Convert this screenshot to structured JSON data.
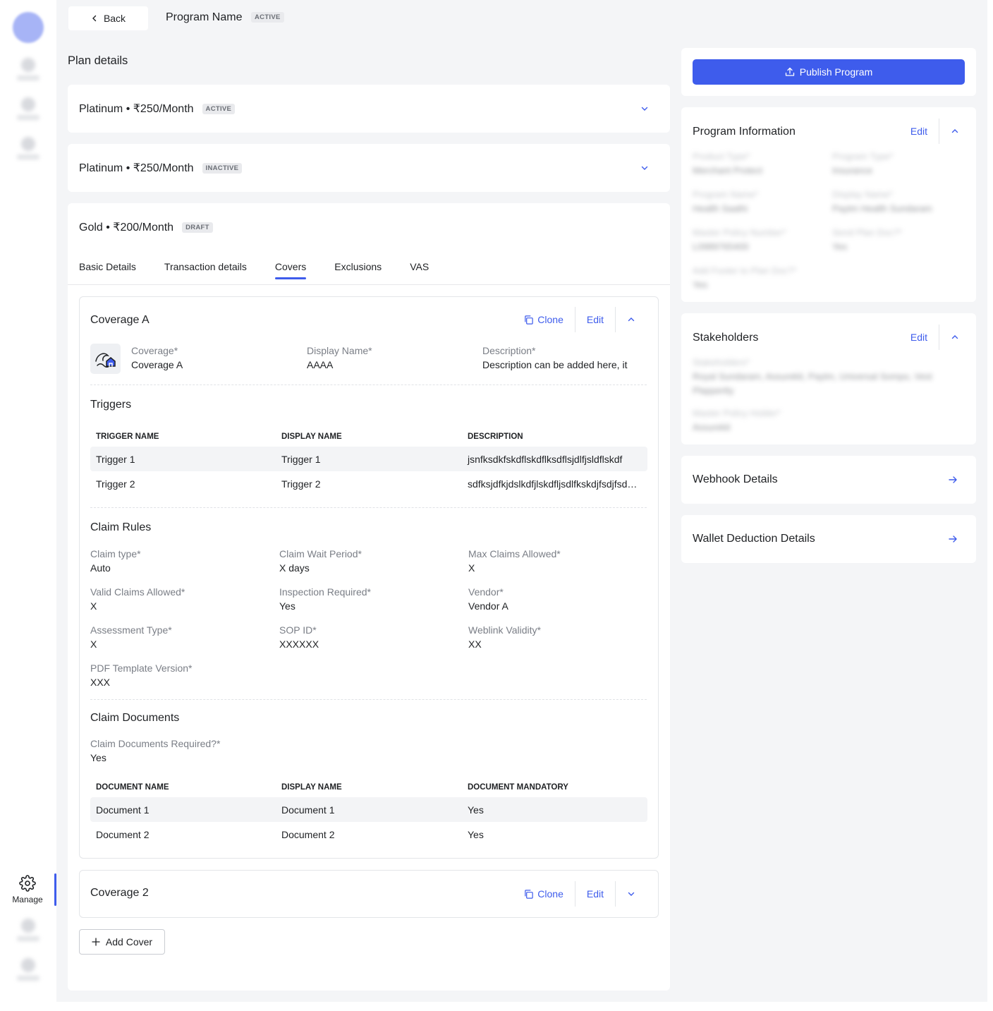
{
  "colors": {
    "accent": "#3e5cec",
    "badge_bg": "#e9eaed",
    "background": "#f4f5f7"
  },
  "sidebar": {
    "manage_label": "Manage",
    "manage_icon": "gear-icon"
  },
  "header": {
    "back_label": "Back",
    "program_name": "Program Name",
    "program_status": "ACTIVE"
  },
  "plan_details": {
    "title": "Plan details",
    "plans": [
      {
        "title": "Platinum • ₹250/Month",
        "status": "ACTIVE"
      },
      {
        "title": "Platinum • ₹250/Month",
        "status": "INACTIVE"
      },
      {
        "title": "Gold • ₹200/Month",
        "status": "DRAFT"
      }
    ]
  },
  "tabs": [
    "Basic Details",
    "Transaction details",
    "Covers",
    "Exclusions",
    "VAS"
  ],
  "active_tab": "Covers",
  "coverage_a": {
    "title": "Coverage A",
    "clone_label": "Clone",
    "edit_label": "Edit",
    "fields": [
      {
        "label": "Coverage*",
        "value": "Coverage A"
      },
      {
        "label": "Display Name*",
        "value": "AAAA"
      },
      {
        "label": "Description*",
        "value": "Description can be added here, it"
      }
    ],
    "triggers": {
      "title": "Triggers",
      "headers": [
        "TRIGGER NAME",
        "DISPLAY NAME",
        "DESCRIPTION"
      ],
      "rows": [
        [
          "Trigger 1",
          "Trigger 1",
          "jsnfksdkfskdflskdflksdflsjdlfjsldflskdf"
        ],
        [
          "Trigger 2",
          "Trigger 2",
          "sdfksjdfkjdslkdfjlskdfljsdlfkskdjfsdjfsdkfjsdf"
        ]
      ]
    },
    "claim_rules": {
      "title": "Claim Rules",
      "fields": [
        {
          "label": "Claim type*",
          "value": "Auto"
        },
        {
          "label": "Claim Wait Period*",
          "value": "X days"
        },
        {
          "label": "Max Claims Allowed*",
          "value": "X"
        },
        {
          "label": "Valid Claims Allowed*",
          "value": "X"
        },
        {
          "label": "Inspection Required*",
          "value": "Yes"
        },
        {
          "label": "Vendor*",
          "value": "Vendor A"
        },
        {
          "label": "Assessment Type*",
          "value": "X"
        },
        {
          "label": "SOP ID*",
          "value": "XXXXXX"
        },
        {
          "label": "Weblink Validity*",
          "value": "XX"
        },
        {
          "label": "PDF Template Version*",
          "value": "XXX"
        }
      ]
    },
    "claim_documents": {
      "title": "Claim Documents",
      "required_label": "Claim Documents Required?*",
      "required_value": "Yes",
      "headers": [
        "DOCUMENT NAME",
        "DISPLAY NAME",
        "DOCUMENT MANDATORY"
      ],
      "rows": [
        [
          "Document 1",
          "Document 1",
          "Yes"
        ],
        [
          "Document 2",
          "Document 2",
          "Yes"
        ]
      ]
    }
  },
  "coverage_2": {
    "title": "Coverage 2",
    "clone_label": "Clone",
    "edit_label": "Edit"
  },
  "add_cover_label": "Add Cover",
  "right": {
    "publish_label": "Publish Program",
    "program_info": {
      "title": "Program Information",
      "edit_label": "Edit",
      "fields": [
        {
          "label": "Product Type*",
          "value": "Merchant Protect"
        },
        {
          "label": "Program Type*",
          "value": "Insurance"
        },
        {
          "label": "Program Name*",
          "value": "Health Saathi"
        },
        {
          "label": "Display Name*",
          "value": "Paytm Health Sundaram"
        },
        {
          "label": "Master Policy Number*",
          "value": "L0989765400"
        },
        {
          "label": "Send Plan Doc?*",
          "value": "Yes"
        },
        {
          "label": "Add Footer to Plan Doc?*",
          "value": "Yes"
        }
      ]
    },
    "stakeholders": {
      "title": "Stakeholders",
      "edit_label": "Edit",
      "fields": [
        {
          "label": "Stakeholders*",
          "value": "Royal Sundaram, Assurekit, Paytm, Universal Sompo, Vest Plappertty"
        },
        {
          "label": "Master Policy Holder*",
          "value": "Assurekit"
        }
      ]
    },
    "webhook_label": "Webhook Details",
    "wallet_label": "Wallet Deduction Details"
  }
}
